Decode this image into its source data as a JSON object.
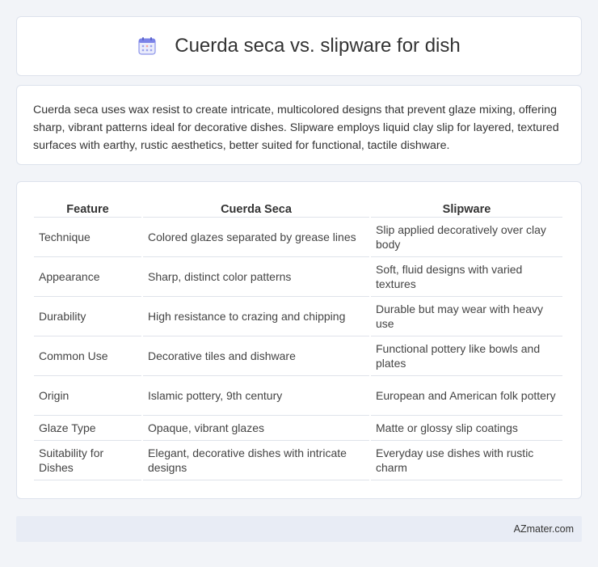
{
  "header": {
    "title": "Cuerda seca vs. slipware for dish",
    "icon": "calendar-icon"
  },
  "summary": {
    "text": "Cuerda seca uses wax resist to create intricate, multicolored designs that prevent glaze mixing, offering sharp, vibrant patterns ideal for decorative dishes. Slipware employs liquid clay slip for layered, textured surfaces with earthy, rustic aesthetics, better suited for functional, tactile dishware."
  },
  "table": {
    "headers": [
      "Feature",
      "Cuerda Seca",
      "Slipware"
    ],
    "rows": [
      [
        "Technique",
        "Colored glazes separated by grease lines",
        "Slip applied decoratively over clay body"
      ],
      [
        "Appearance",
        "Sharp, distinct color patterns",
        "Soft, fluid designs with varied textures"
      ],
      [
        "Durability",
        "High resistance to crazing and chipping",
        "Durable but may wear with heavy use"
      ],
      [
        "Common Use",
        "Decorative tiles and dishware",
        "Functional pottery like bowls and plates"
      ],
      [
        "Origin",
        "Islamic pottery, 9th century",
        "European and American folk pottery"
      ],
      [
        "Glaze Type",
        "Opaque, vibrant glazes",
        "Matte or glossy slip coatings"
      ],
      [
        "Suitability for Dishes",
        "Elegant, decorative dishes with intricate designs",
        "Everyday use dishes with rustic charm"
      ]
    ]
  },
  "footer": {
    "text": "AZmater.com"
  },
  "colors": {
    "background": "#f2f4f8",
    "card": "#ffffff",
    "icon_accent": "#7b83e8",
    "footer_bg": "#e8ecf5"
  }
}
